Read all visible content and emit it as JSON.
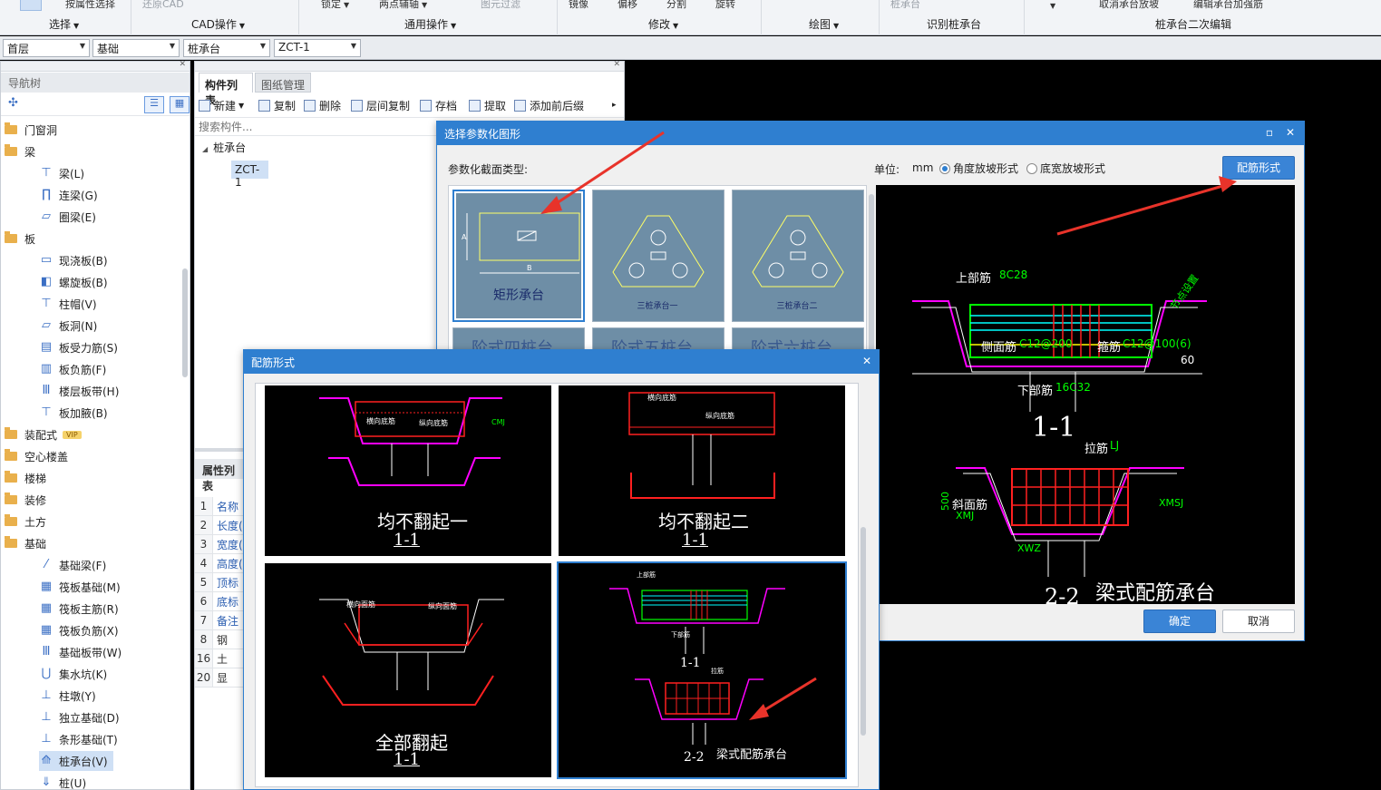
{
  "ribbon": {
    "groups": [
      {
        "top": "按属性选择",
        "label": "选择",
        "top2": "还原CAD"
      },
      {
        "top": "",
        "label": "CAD操作"
      },
      {
        "top": "锁定",
        "top2": "两点辅轴",
        "top3": "图元过滤",
        "label": "通用操作"
      },
      {
        "top": "镜像",
        "top2": "偏移",
        "top3": "分割",
        "top4": "旋转",
        "label": "修改"
      },
      {
        "label": "绘图"
      },
      {
        "top": "桩承台",
        "label": "识别桩承台"
      },
      {
        "top": "取消承台放坡",
        "top2": "编辑承台加强筋",
        "label": "桩承台二次编辑"
      }
    ]
  },
  "selectors": [
    "首层",
    "基础",
    "桩承台",
    "ZCT-1"
  ],
  "nav": {
    "title": "导航树",
    "items": [
      {
        "label": "门窗洞",
        "type": "folder"
      },
      {
        "label": "梁",
        "type": "folder"
      },
      {
        "label": "梁(L)",
        "type": "item",
        "icon": "beam-icon"
      },
      {
        "label": "连梁(G)",
        "type": "item",
        "icon": "link-beam-icon"
      },
      {
        "label": "圈梁(E)",
        "type": "item",
        "icon": "ring-beam-icon"
      },
      {
        "label": "板",
        "type": "folder"
      },
      {
        "label": "现浇板(B)",
        "type": "item",
        "icon": "slab-icon"
      },
      {
        "label": "螺旋板(B)",
        "type": "item",
        "icon": "spiral-slab-icon"
      },
      {
        "label": "柱帽(V)",
        "type": "item",
        "icon": "column-cap-icon"
      },
      {
        "label": "板洞(N)",
        "type": "item",
        "icon": "slab-hole-icon"
      },
      {
        "label": "板受力筋(S)",
        "type": "item",
        "icon": "slab-rebar-icon"
      },
      {
        "label": "板负筋(F)",
        "type": "item",
        "icon": "slab-neg-rebar-icon"
      },
      {
        "label": "楼层板带(H)",
        "type": "item",
        "icon": "floor-band-icon"
      },
      {
        "label": "板加腋(B)",
        "type": "item",
        "icon": "slab-haunch-icon"
      },
      {
        "label": "装配式",
        "type": "folder",
        "badge": "VIP"
      },
      {
        "label": "空心楼盖",
        "type": "folder"
      },
      {
        "label": "楼梯",
        "type": "folder"
      },
      {
        "label": "装修",
        "type": "folder"
      },
      {
        "label": "土方",
        "type": "folder"
      },
      {
        "label": "基础",
        "type": "folder"
      },
      {
        "label": "基础梁(F)",
        "type": "item",
        "icon": "foundation-beam-icon"
      },
      {
        "label": "筏板基础(M)",
        "type": "item",
        "icon": "raft-icon"
      },
      {
        "label": "筏板主筋(R)",
        "type": "item",
        "icon": "raft-main-rebar-icon"
      },
      {
        "label": "筏板负筋(X)",
        "type": "item",
        "icon": "raft-neg-rebar-icon"
      },
      {
        "label": "基础板带(W)",
        "type": "item",
        "icon": "foundation-band-icon"
      },
      {
        "label": "集水坑(K)",
        "type": "item",
        "icon": "sump-icon"
      },
      {
        "label": "柱墩(Y)",
        "type": "item",
        "icon": "column-pier-icon"
      },
      {
        "label": "独立基础(D)",
        "type": "item",
        "icon": "isolated-footing-icon"
      },
      {
        "label": "条形基础(T)",
        "type": "item",
        "icon": "strip-footing-icon"
      },
      {
        "label": "桩承台(V)",
        "type": "item",
        "icon": "pile-cap-icon",
        "selected": true
      },
      {
        "label": "桩(U)",
        "type": "item",
        "icon": "pile-icon"
      }
    ]
  },
  "components": {
    "tabs": [
      "构件列表",
      "图纸管理"
    ],
    "toolbar": [
      "新建",
      "复制",
      "删除",
      "层间复制",
      "存档",
      "提取",
      "添加前后缀"
    ],
    "search_placeholder": "搜索构件...",
    "tree_root": "桩承台",
    "tree_child": "ZCT-1"
  },
  "props": {
    "title": "属性列表",
    "rows": [
      {
        "n": "1",
        "v": "名称"
      },
      {
        "n": "2",
        "v": "长度("
      },
      {
        "n": "3",
        "v": "宽度("
      },
      {
        "n": "4",
        "v": "高度("
      },
      {
        "n": "5",
        "v": "顶标"
      },
      {
        "n": "6",
        "v": "底标"
      },
      {
        "n": "7",
        "v": "备注"
      },
      {
        "n": "8",
        "v": "钢"
      },
      {
        "n": "16",
        "v": "土"
      },
      {
        "n": "20",
        "v": "显"
      }
    ]
  },
  "dialog_shape": {
    "title": "选择参数化图形",
    "section_label": "参数化截面类型:",
    "unit_label": "单位:",
    "unit_value": "mm",
    "radio1": "角度放坡形式",
    "radio2": "底宽放坡形式",
    "rebar_form_btn": "配筋形式",
    "thumbs": [
      "矩形承台",
      "三桩承台一",
      "三桩承台二"
    ],
    "thumbs_row2": [
      "阶式四桩台",
      "阶式五桩台",
      "阶式六桩台"
    ],
    "ok": "确定",
    "cancel": "取消",
    "preview": {
      "top_label": "上部筋",
      "top_spec": "8C28",
      "side_label": "侧面筋",
      "side_spec": "C12@200",
      "stirrup_label": "箍筋",
      "stirrup_spec": "C12@100(6)",
      "bottom_label": "下部筋",
      "bottom_spec": "16C32",
      "section1": "1-1",
      "tie_label": "拉筋",
      "tie_spec": "LJ",
      "slope_label": "斜面筋",
      "slope_spec": "XMJ",
      "slope_spec2": "XMSJ",
      "xwz": "XWZ",
      "section2": "2-2",
      "caption": "梁式配筋承台",
      "dim_500": "500",
      "dim_60": "60",
      "node_note": "节点设置"
    }
  },
  "dialog_rebar": {
    "title": "配筋形式",
    "cells": [
      {
        "title": "均不翻起一",
        "section": "1-1"
      },
      {
        "title": "均不翻起二",
        "section": "1-1"
      },
      {
        "title": "全部翻起",
        "section": "1-1"
      },
      {
        "title": "梁式配筋承台",
        "section": "1-1",
        "section2": "2-2",
        "selected": true
      }
    ],
    "labels": {
      "hxdj": "横向面筋",
      "zxdj": "纵向面筋",
      "hxd": "横向底筋",
      "zxd": "纵向底筋",
      "cmj": "CMJ",
      "top": "上部筋",
      "bottom": "下部筋",
      "tie": "拉筋"
    }
  },
  "colors": {
    "accent": "#2f7fd0",
    "cad_green": "#00ff00",
    "cad_red": "#ff2020",
    "cad_magenta": "#ff00ff",
    "cad_cyan": "#00ffff",
    "cad_yellow": "#ffff00",
    "arrow_red": "#e8332a"
  }
}
